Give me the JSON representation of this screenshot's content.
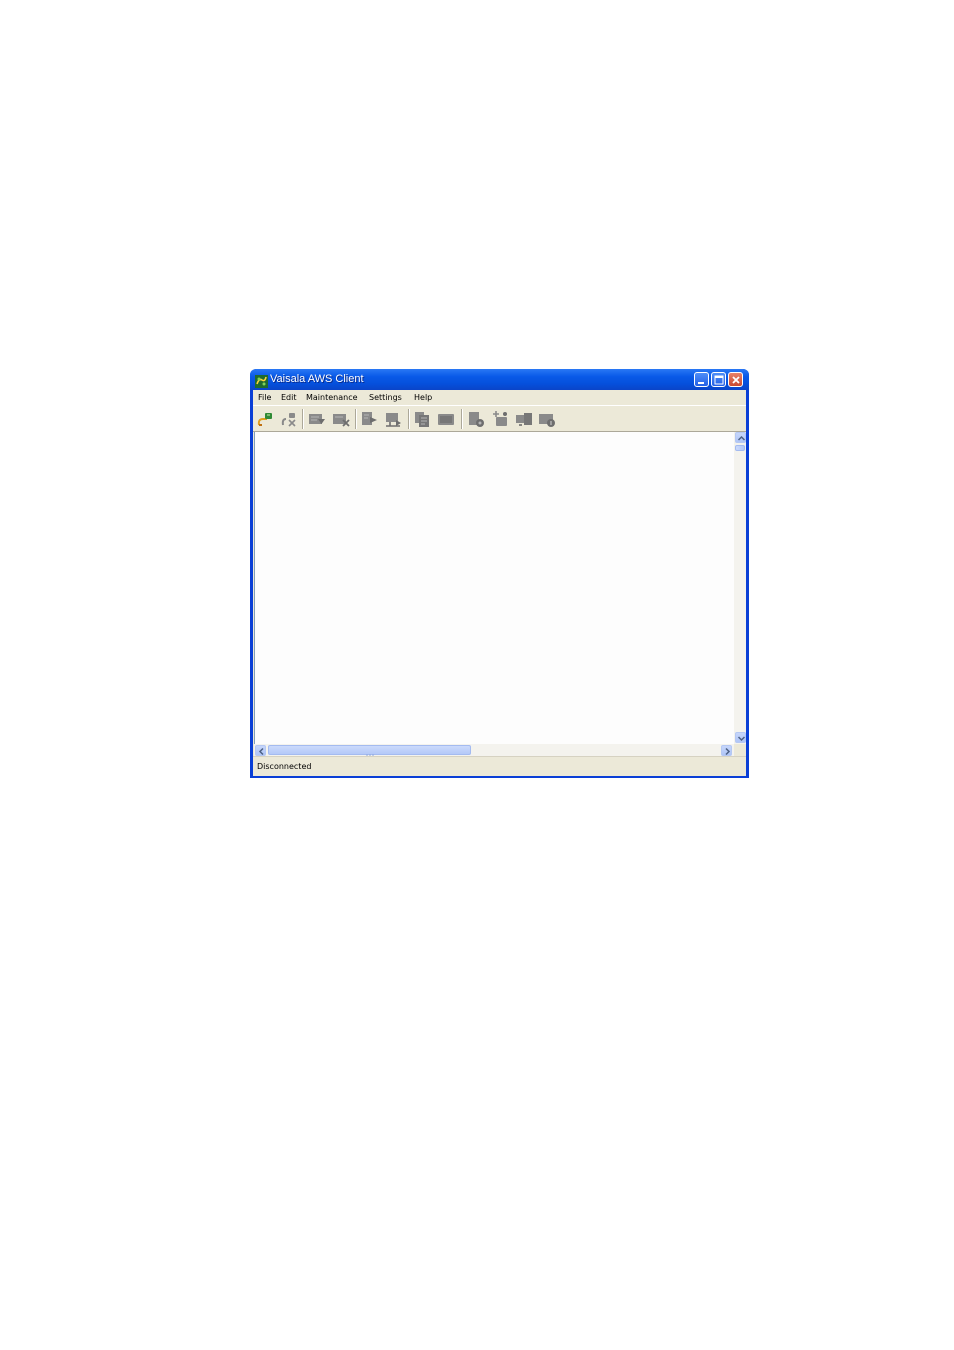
{
  "window": {
    "title": "Vaisala AWS Client",
    "controls": [
      "minimize-icon",
      "maximize-icon",
      "close-icon"
    ]
  },
  "menubar": {
    "items": [
      "File",
      "Edit",
      "Maintenance",
      "Settings",
      "Help"
    ]
  },
  "toolbar": {
    "buttons": [
      {
        "name": "connect-icon",
        "enabled": true
      },
      {
        "name": "disconnect-icon",
        "enabled": false
      },
      {
        "name": "download-icon",
        "enabled": false
      },
      {
        "name": "delete-log-icon",
        "enabled": false
      },
      {
        "name": "open-file-icon",
        "enabled": false
      },
      {
        "name": "upload-icon",
        "enabled": false
      },
      {
        "name": "copy-icon",
        "enabled": false
      },
      {
        "name": "message-icon",
        "enabled": false
      },
      {
        "name": "settings-icon",
        "enabled": false
      },
      {
        "name": "sensor-icon",
        "enabled": false
      },
      {
        "name": "monitor-icon",
        "enabled": false
      },
      {
        "name": "info-icon",
        "enabled": false
      }
    ]
  },
  "statusbar": {
    "text": "Disconnected"
  },
  "colors": {
    "titlebar": "#0550dc",
    "frame": "#0a3fd6",
    "chrome": "#ece9d8",
    "disabled_icon": "#8a8a8a"
  }
}
